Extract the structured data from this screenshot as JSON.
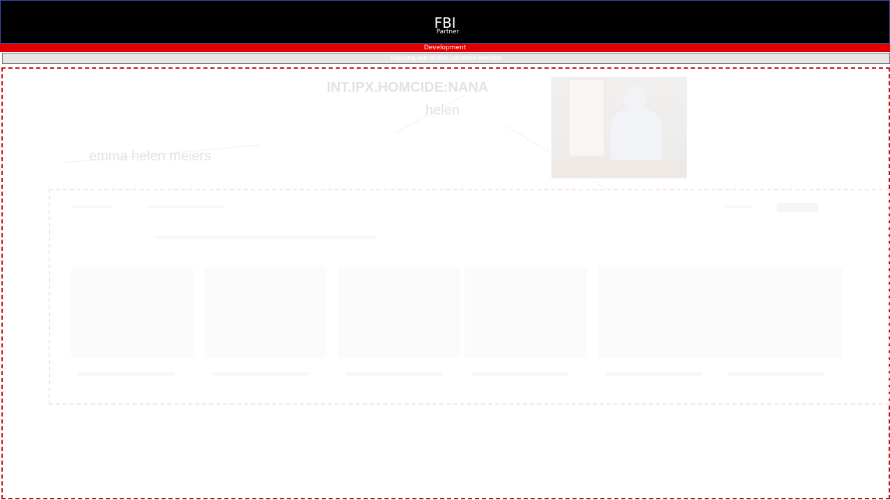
{
  "header": {
    "title": "FBI",
    "subtitle": "Partner"
  },
  "environment": {
    "label": "Development"
  },
  "notice": {
    "text": "Slipping out of the Location horizon"
  },
  "graph": {
    "case_title": "INT.IPX.HOMCIDE:NANA",
    "person_name": "helen",
    "related_name": "emma helen meiers",
    "photo_icon": "portrait-photo"
  },
  "colors": {
    "header_bg": "#000000",
    "env_bar": "#e00000",
    "canvas_border": "#c41111",
    "faded_text": "#e2e2e2"
  }
}
